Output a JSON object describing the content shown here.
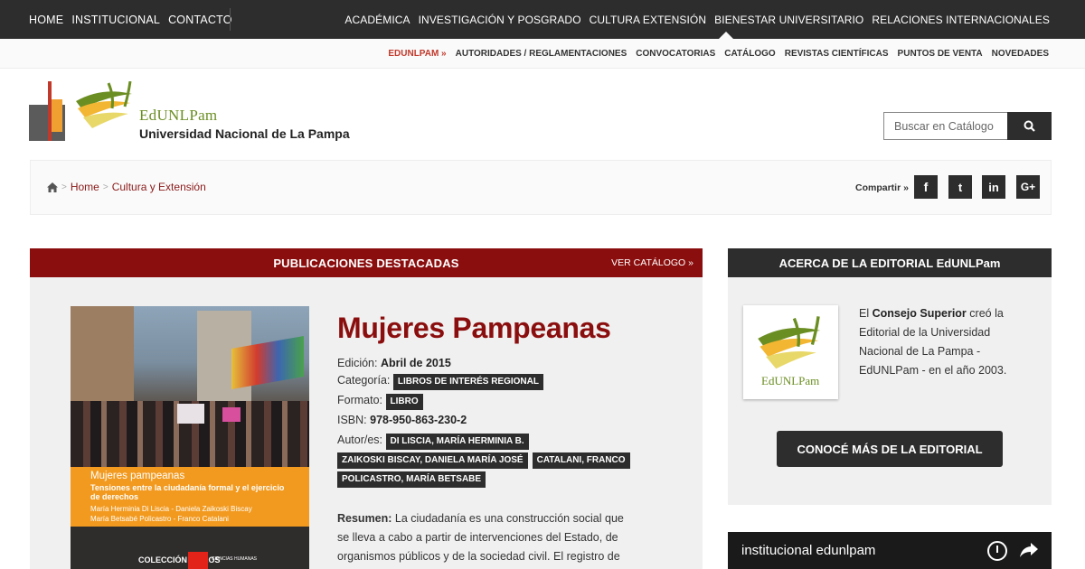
{
  "topnav": {
    "left": [
      "HOME",
      "INSTITUCIONAL",
      "CONTACTO"
    ],
    "right": [
      "ACADÉMICA",
      "INVESTIGACIÓN Y POSGRADO",
      "CULTURA EXTENSIÓN",
      "BIENESTAR UNIVERSITARIO",
      "RELACIONES INTERNACIONALES"
    ]
  },
  "subnav": {
    "active": "EDUNLPAM »",
    "items": [
      "AUTORIDADES / REGLAMENTACIONES",
      "CONVOCATORIAS",
      "CATÁLOGO",
      "REVISTAS CIENTÍFICAS",
      "PUNTOS DE VENTA",
      "NOVEDADES"
    ]
  },
  "header": {
    "brand": "EdUNLPam",
    "university": "Universidad Nacional de La Pampa"
  },
  "search": {
    "placeholder": "Buscar en Catálogo"
  },
  "breadcrumb": {
    "home": "Home",
    "section": "Cultura y Extensión"
  },
  "share": {
    "label": "Compartir »",
    "networks": [
      "f",
      "t",
      "in",
      "G+"
    ]
  },
  "featured": {
    "title": "PUBLICACIONES DESTACADAS",
    "catalog_link": "VER CATÁLOGO »"
  },
  "book": {
    "title": "Mujeres Pampeanas",
    "edition_label": "Edición:",
    "edition": "Abril de 2015",
    "category_label": "Categoría:",
    "category": "LIBROS DE INTERÉS REGIONAL",
    "format_label": "Formato:",
    "format": "LIBRO",
    "isbn_label": "ISBN:",
    "isbn": "978-950-863-230-2",
    "authors_label": "Autor/es:",
    "authors": [
      "DI LISCIA, MARÍA HERMINIA B.",
      "ZAIKOSKI BISCAY, DANIELA MARÍA JOSÉ",
      "CATALANI, FRANCO",
      "POLICASTRO, MARÍA BETSABE"
    ],
    "summary_label": "Resumen:",
    "summary": "La ciudadanía es una construcción social que se lleva a cabo a partir de intervenciones del Estado, de organismos públicos y de la sociedad civil. El registro de",
    "cover": {
      "title": "Mujeres pampeanas",
      "subtitle": "Tensiones entre la ciudadanía formal y el ejercicio de derechos",
      "authors_line1": "María Herminia Di Liscia - Daniela Zaikoski Biscay",
      "authors_line2": "María Betsabé Policastro - Franco Catalani",
      "collection": "COLECCIÓN LIBROS",
      "area": "CIENCIAS HUMANAS"
    }
  },
  "sidebar": {
    "title": "ACERCA DE LA EDITORIAL EdUNLPam",
    "logo_text": "EdUNLPam",
    "text_pre": "El",
    "text_bold": "Consejo Superior",
    "text_post": "creó la Editorial de la Universidad Nacional de La Pampa - EdUNLPam - en el año 2003.",
    "button": "CONOCÉ MÁS DE LA EDITORIAL"
  },
  "video": {
    "title": "institucional edunlpam"
  },
  "colors": {
    "accent": "#8b0e0e",
    "dark": "#2d2d2d",
    "panel": "#f0f0f0"
  }
}
